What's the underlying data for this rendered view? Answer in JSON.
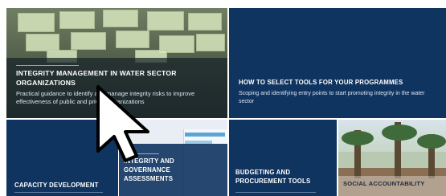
{
  "tiles": [
    {
      "title": "INTEGRITY MANAGEMENT IN WATER SECTOR ORGANIZATIONS",
      "description": "Practical guidance to identify and manage integrity risks to improve effectiveness of public and private organizations"
    },
    {
      "title": "HOW TO SELECT TOOLS FOR YOUR PROGRAMMES",
      "description": "Scoping and identifying entry points to start promoting integrity in the water sector"
    },
    {
      "title": "CAPACITY DEVELOPMENT"
    },
    {
      "title": "INTEGRITY AND GOVERNANCE ASSESSMENTS"
    },
    {
      "title": "BUDGETING AND PROCUREMENT TOOLS"
    },
    {
      "title": "SOCIAL ACCOUNTABILITY"
    }
  ],
  "colors": {
    "navy": "#0f3460",
    "text": "#ffffff"
  },
  "icons": {
    "cursor": "mouse-pointer-icon"
  }
}
